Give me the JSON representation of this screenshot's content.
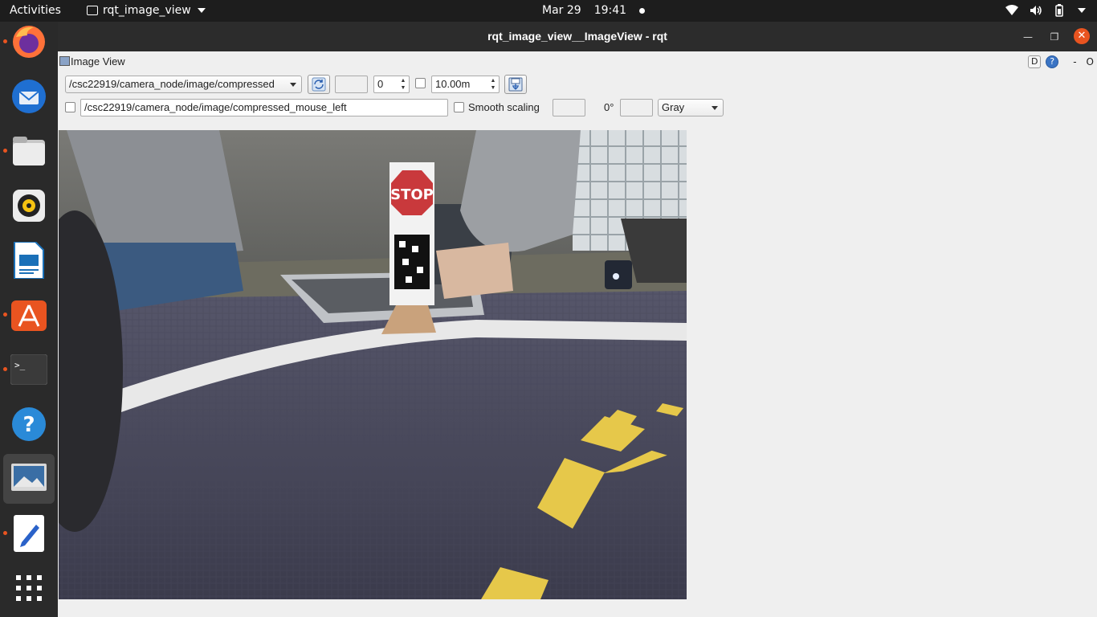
{
  "topbar": {
    "activities": "Activities",
    "app_name": "rqt_image_view",
    "date": "Mar 29",
    "time": "19:41"
  },
  "dock": {
    "items": [
      {
        "name": "firefox-icon"
      },
      {
        "name": "thunderbird-icon"
      },
      {
        "name": "files-icon"
      },
      {
        "name": "rhythmbox-icon"
      },
      {
        "name": "writer-icon"
      },
      {
        "name": "software-icon"
      },
      {
        "name": "terminal-icon"
      },
      {
        "name": "help-icon"
      },
      {
        "name": "image-viewer-icon"
      },
      {
        "name": "text-editor-icon"
      },
      {
        "name": "show-apps-icon"
      }
    ]
  },
  "window": {
    "title": "rqt_image_view__ImageView - rqt"
  },
  "plugin": {
    "title": "Image View",
    "help_d": "D",
    "help_q": "?",
    "dash": "-",
    "o": "O"
  },
  "toolbar": {
    "topic": "/csc22919/camera_node/image/compressed",
    "blank_field": "",
    "spin_value": "0",
    "max_range": "10.00m",
    "mouse_topic": "/csc22919/camera_node/image/compressed_mouse_left",
    "smooth_scaling": "Smooth scaling",
    "rotation": "0°",
    "color_scheme": "Gray"
  },
  "image": {
    "sign_text": "STOP"
  }
}
